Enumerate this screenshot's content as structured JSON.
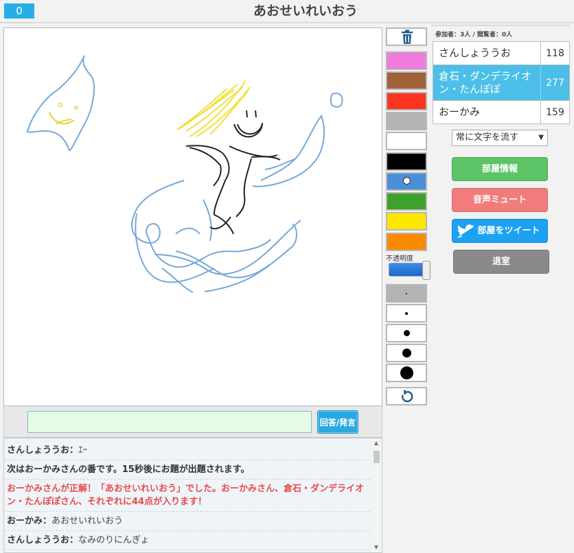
{
  "header": {
    "score": "0",
    "title": "あおせいれいおう"
  },
  "answer": {
    "value": "",
    "button_label": "回答/発言"
  },
  "chat": [
    {
      "type": "user",
      "name": "さんしょううお：",
      "msg": "ｴｰ"
    },
    {
      "type": "system",
      "text": "次はおーかみさんの番です。15秒後にお題が出題されます。"
    },
    {
      "type": "correct",
      "text": "おーかみさんが正解！「あおせいれいおう」でした。おーかみさん、倉石・ダンデライオン・たんぽぽさん、それぞれに44点が入ります！"
    },
    {
      "type": "user",
      "name": "おーかみ：",
      "msg": "あおせいれいおう"
    },
    {
      "type": "user",
      "name": "さんしょううお：",
      "msg": "なみのりにんぎょ"
    }
  ],
  "tools": {
    "colors": [
      "#f07bdc",
      "#9e6338",
      "#fa3620",
      "#b4b4b4",
      "#ffffff",
      "#000000",
      "#4a8fd8",
      "#3da12d",
      "#fde600",
      "#fa8a00"
    ],
    "selected_color_index": 6,
    "opacity_label": "不透明度",
    "opacity_level": 1.0,
    "sizes": [
      2,
      4,
      9,
      13,
      19
    ],
    "selected_size_index": 0,
    "icons": {
      "clear": "trash-icon",
      "undo": "undo-icon"
    }
  },
  "panel": {
    "participants_label": "参加者：3人 / 閲覧者：0人",
    "players": [
      {
        "name": "さんしょううお",
        "score": "118",
        "drawer": false
      },
      {
        "name": "倉石・ダンデライオン・たんぽぽ",
        "score": "277",
        "drawer": true
      },
      {
        "name": "おーかみ",
        "score": "159",
        "drawer": false
      }
    ],
    "flow_select": "常に文字を流す",
    "room_info": "部屋情報",
    "mute": "音声ミュート",
    "tweet": "部屋をツイート",
    "exit": "退室",
    "colors": {
      "info": "#5cc466",
      "mute": "#f27c7c",
      "tweet": "#1da1f2",
      "exit": "#8a8a8a",
      "drawer_row": "#4bbfe8"
    }
  }
}
